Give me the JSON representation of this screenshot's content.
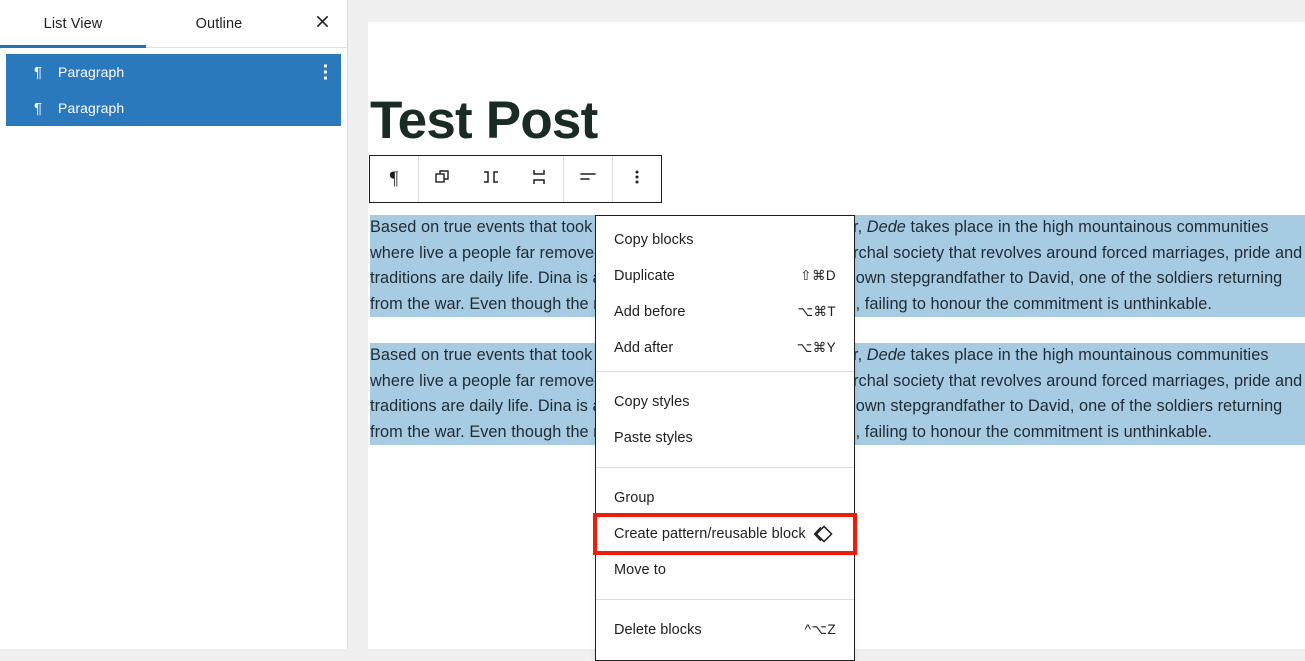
{
  "list_view_panel": {
    "tabs": [
      {
        "label": "List View",
        "name": "tab-list-view",
        "active": true
      },
      {
        "label": "Outline",
        "name": "tab-outline",
        "active": false
      }
    ],
    "close_icon": "close-icon",
    "items": [
      {
        "label": "Paragraph",
        "icon": "pilcrow-icon",
        "selected": true,
        "has_kebab": true
      },
      {
        "label": "Paragraph",
        "icon": "pilcrow-icon",
        "selected": true,
        "has_kebab": false
      }
    ],
    "selected_color": "#2b79bd",
    "active_tab_underline_color": "#2271b1"
  },
  "editor": {
    "post_title": "Test Post",
    "title_color": "#1a2b23",
    "selection_highlight_color": "#a7cbe3",
    "paragraphs": [
      {
        "part1": "Based on true events that took place during the Tajikistani Civil War, ",
        "italic": "Dede",
        "part2": " takes place in the high mountainous communities where live a people far removed from the rest of the world. A patriarchal society that revolves around forced marriages, pride and traditions are daily life. Dina is a young woman forced to marry her own stepgrandfather to David, one of the soldiers returning from the war. Even though the marriage is brokered by two families, failing to honour the commitment is unthinkable."
      },
      {
        "part1": "Based on true events that took place during the Tajikistani Civil War, ",
        "italic": "Dede",
        "part2": " takes place in the high mountainous communities where live a people far removed from the rest of the world. A patriarchal society that revolves around forced marriages, pride and traditions are daily life. Dina is a young woman forced to marry her own stepgrandfather to David, one of the soldiers returning from the war. Even though the marriage is brokered by two families, failing to honour the commitment is unthinkable."
      }
    ]
  },
  "block_toolbar": {
    "buttons": [
      {
        "name": "paragraph-block-type-icon",
        "icon": "pilcrow-icon",
        "glyph": "¶"
      },
      {
        "name": "multiple-blocks-selected-icon",
        "icon": "copy-blocks-icon"
      },
      {
        "name": "align-horizontal-icon",
        "icon": "justify-horizontal-icon"
      },
      {
        "name": "align-vertical-icon",
        "icon": "justify-vertical-icon"
      },
      {
        "name": "align-text-icon",
        "icon": "align-left-icon"
      },
      {
        "name": "more-options-icon",
        "icon": "kebab-icon"
      }
    ]
  },
  "block_menu": {
    "sections": [
      {
        "items": [
          {
            "label": "Copy blocks",
            "shortcut": "",
            "name": "menu-item-copy-blocks",
            "highlighted": false,
            "icon": ""
          },
          {
            "label": "Duplicate",
            "shortcut": "⇧⌘D",
            "name": "menu-item-duplicate",
            "highlighted": false,
            "icon": ""
          },
          {
            "label": "Add before",
            "shortcut": "⌥⌘T",
            "name": "menu-item-add-before",
            "highlighted": false,
            "icon": ""
          },
          {
            "label": "Add after",
            "shortcut": "⌥⌘Y",
            "name": "menu-item-add-after",
            "highlighted": false,
            "icon": ""
          }
        ]
      },
      {
        "items": [
          {
            "label": "Copy styles",
            "shortcut": "",
            "name": "menu-item-copy-styles",
            "highlighted": false,
            "icon": ""
          },
          {
            "label": "Paste styles",
            "shortcut": "",
            "name": "menu-item-paste-styles",
            "highlighted": false,
            "icon": ""
          }
        ]
      },
      {
        "items": [
          {
            "label": "Group",
            "shortcut": "",
            "name": "menu-item-group",
            "highlighted": false,
            "icon": ""
          },
          {
            "label": "Create pattern/reusable block",
            "shortcut": "",
            "name": "menu-item-create-pattern",
            "highlighted": true,
            "icon": "reusable-block-icon"
          },
          {
            "label": "Move to",
            "shortcut": "",
            "name": "menu-item-move-to",
            "highlighted": false,
            "icon": ""
          }
        ]
      },
      {
        "items": [
          {
            "label": "Delete blocks",
            "shortcut": "^⌥Z",
            "name": "menu-item-delete-blocks",
            "highlighted": false,
            "icon": ""
          }
        ]
      }
    ],
    "highlight_color": "#f01c0a"
  }
}
